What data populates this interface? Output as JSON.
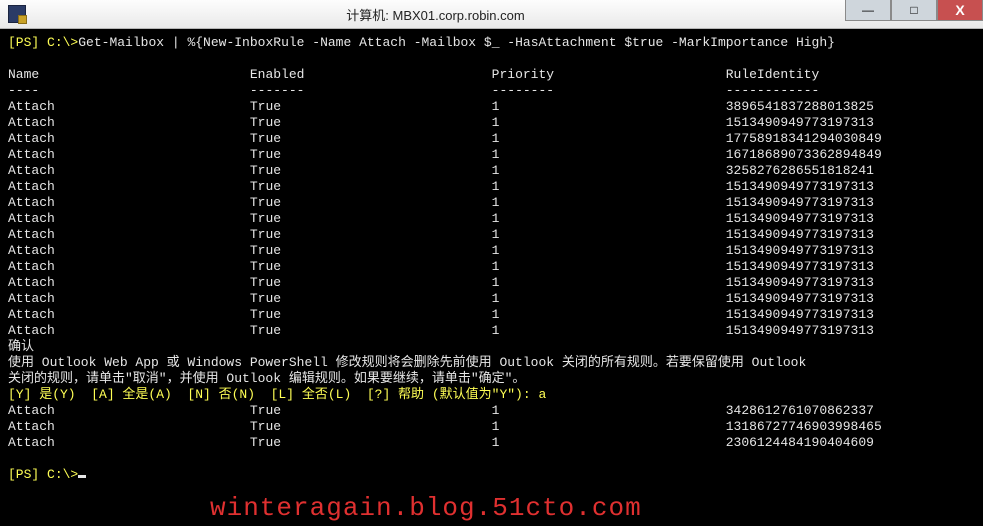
{
  "window": {
    "title": "计算机: MBX01.corp.robin.com"
  },
  "prompt": {
    "ps_open": "[PS]",
    "path": " C:\\>",
    "command": "Get-Mailbox | %{New-InboxRule -Name Attach -Mailbox $_ -HasAttachment $true -MarkImportance High}"
  },
  "headers": {
    "name": "Name",
    "enabled": "Enabled",
    "priority": "Priority",
    "ruleId": "RuleIdentity"
  },
  "dashes": {
    "name": "----",
    "enabled": "-------",
    "priority": "--------",
    "ruleId": "------------"
  },
  "rows": [
    {
      "name": "Attach",
      "enabled": "True",
      "priority": "1",
      "ruleId": "3896541837288013825"
    },
    {
      "name": "Attach",
      "enabled": "True",
      "priority": "1",
      "ruleId": "1513490949773197313"
    },
    {
      "name": "Attach",
      "enabled": "True",
      "priority": "1",
      "ruleId": "17758918341294030849"
    },
    {
      "name": "Attach",
      "enabled": "True",
      "priority": "1",
      "ruleId": "16718689073362894849"
    },
    {
      "name": "Attach",
      "enabled": "True",
      "priority": "1",
      "ruleId": "3258276286551818241"
    },
    {
      "name": "Attach",
      "enabled": "True",
      "priority": "1",
      "ruleId": "1513490949773197313"
    },
    {
      "name": "Attach",
      "enabled": "True",
      "priority": "1",
      "ruleId": "1513490949773197313"
    },
    {
      "name": "Attach",
      "enabled": "True",
      "priority": "1",
      "ruleId": "1513490949773197313"
    },
    {
      "name": "Attach",
      "enabled": "True",
      "priority": "1",
      "ruleId": "1513490949773197313"
    },
    {
      "name": "Attach",
      "enabled": "True",
      "priority": "1",
      "ruleId": "1513490949773197313"
    },
    {
      "name": "Attach",
      "enabled": "True",
      "priority": "1",
      "ruleId": "1513490949773197313"
    },
    {
      "name": "Attach",
      "enabled": "True",
      "priority": "1",
      "ruleId": "1513490949773197313"
    },
    {
      "name": "Attach",
      "enabled": "True",
      "priority": "1",
      "ruleId": "1513490949773197313"
    },
    {
      "name": "Attach",
      "enabled": "True",
      "priority": "1",
      "ruleId": "1513490949773197313"
    },
    {
      "name": "Attach",
      "enabled": "True",
      "priority": "1",
      "ruleId": "1513490949773197313"
    }
  ],
  "confirm": {
    "title": "确认",
    "line1": "使用 Outlook Web App 或 Windows PowerShell 修改规则将会删除先前使用 Outlook 关闭的所有规则。若要保留使用 Outlook",
    "line2": "关闭的规则，请单击\"取消\"，并使用 Outlook 编辑规则。如果要继续，请单击\"确定\"。",
    "options": "[Y] 是(Y)  [A] 全是(A)  [N] 否(N)  [L] 全否(L)  [?] 帮助 (默认值为\"Y\"): a"
  },
  "rows2": [
    {
      "name": "Attach",
      "enabled": "True",
      "priority": "1",
      "ruleId": "3428612761070862337"
    },
    {
      "name": "Attach",
      "enabled": "True",
      "priority": "1",
      "ruleId": "13186727746903998465"
    },
    {
      "name": "Attach",
      "enabled": "True",
      "priority": "1",
      "ruleId": "2306124484190404609"
    }
  ],
  "prompt2": {
    "ps_open": "[PS]",
    "path": " C:\\>"
  },
  "watermark": "winteragain.blog.51cto.com"
}
